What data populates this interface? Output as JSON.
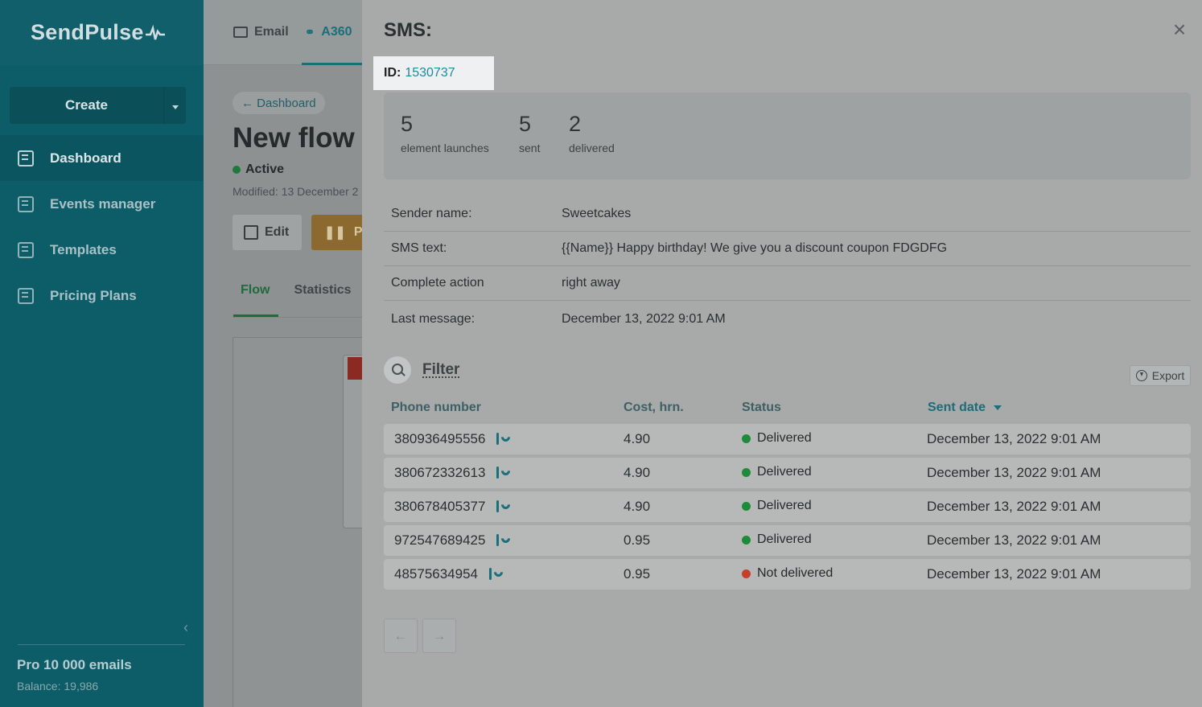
{
  "sidebar": {
    "logo": "SendPulse",
    "create_label": "Create",
    "items": [
      {
        "label": "Dashboard",
        "icon": "dashboard-icon",
        "active": true
      },
      {
        "label": "Events manager",
        "icon": "events-icon",
        "active": false
      },
      {
        "label": "Templates",
        "icon": "templates-icon",
        "active": false
      },
      {
        "label": "Pricing Plans",
        "icon": "wallet-icon",
        "active": false
      }
    ],
    "plan_name": "Pro 10 000 emails",
    "balance": "Balance: 19,986"
  },
  "topbar": {
    "email_label": "Email",
    "a360_label": "A360"
  },
  "main": {
    "breadcrumb": "← Dashboard",
    "title": "New flow",
    "status": "Active",
    "modified": "Modified: 13 December 2",
    "edit_label": "Edit",
    "pause_label": "Pa",
    "tabs": [
      "Flow",
      "Statistics"
    ]
  },
  "panel": {
    "title": "SMS:",
    "id_label": "ID:",
    "id_value": "1530737",
    "close_icon": "×",
    "stats": [
      {
        "value": "5",
        "label": "element launches"
      },
      {
        "value": "5",
        "label": "sent"
      },
      {
        "value": "2",
        "label": "delivered"
      }
    ],
    "info": [
      {
        "key": "Sender name:",
        "value": "Sweetcakes"
      },
      {
        "key": "SMS text:",
        "value": "{{Name}} Happy birthday! We give you a discount coupon FDGDFG"
      },
      {
        "key": "Complete action",
        "value": "right away"
      },
      {
        "key": "Last message:",
        "value": "December 13, 2022 9:01 AM"
      }
    ],
    "filter_label": "Filter",
    "export_label": "Export",
    "columns": [
      "Phone number",
      "Cost, hrn.",
      "Status",
      "Sent date"
    ],
    "rows": [
      {
        "phone": "380936495556",
        "cost": "4.90",
        "status": "Delivered",
        "status_color": "#1f8a3a",
        "date": "December 13, 2022 9:01 AM"
      },
      {
        "phone": "380672332613",
        "cost": "4.90",
        "status": "Delivered",
        "status_color": "#1f8a3a",
        "date": "December 13, 2022 9:01 AM"
      },
      {
        "phone": "380678405377",
        "cost": "4.90",
        "status": "Delivered",
        "status_color": "#1f8a3a",
        "date": "December 13, 2022 9:01 AM"
      },
      {
        "phone": "972547689425",
        "cost": "0.95",
        "status": "Delivered",
        "status_color": "#1f8a3a",
        "date": "December 13, 2022 9:01 AM"
      },
      {
        "phone": "48575634954",
        "cost": "0.95",
        "status": "Not delivered",
        "status_color": "#c2402c",
        "date": "December 13, 2022 9:01 AM"
      }
    ],
    "prev_label": "←",
    "next_label": "→"
  }
}
